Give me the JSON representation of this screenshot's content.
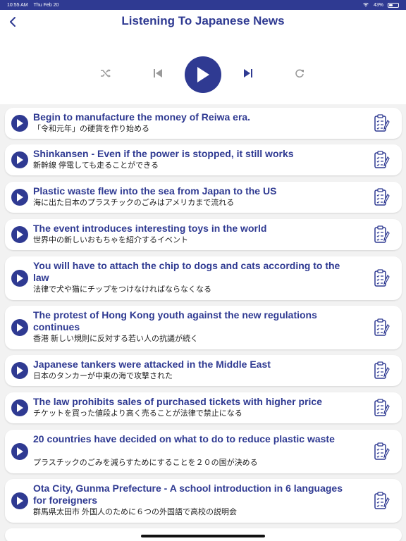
{
  "status_bar": {
    "time": "10:55 AM",
    "date": "Thu Feb 20",
    "battery": "43%",
    "battery_level": 0.43
  },
  "header": {
    "title": "Listening To Japanese News",
    "back_icon": "chevron-left-icon"
  },
  "player": {
    "shuffle_icon": "shuffle-icon",
    "prev_icon": "skip-previous-icon",
    "play_icon": "play-icon",
    "next_icon": "skip-next-icon",
    "repeat_icon": "repeat-icon"
  },
  "colors": {
    "primary": "#2f3a92",
    "background": "#f2f2f2",
    "card": "#ffffff"
  },
  "items": [
    {
      "en": "Begin to manufacture the money of Reiwa era.",
      "jp": "「令和元年」の硬貨を作り始める"
    },
    {
      "en": "Shinkansen - Even if the power is stopped, it still works",
      "jp": "新幹線 停電しても走ることができる"
    },
    {
      "en": "Plastic waste flew into the sea from Japan to the US",
      "jp": "海に出た日本のプラスチックのごみはアメリカまで流れる"
    },
    {
      "en": "The event introduces interesting toys in the world",
      "jp": "世界中の新しいおもちゃを紹介するイベント"
    },
    {
      "en": "You will have to attach the chip to dogs and cats according to the law",
      "jp": "法律で犬や猫にチップをつけなければならなくなる"
    },
    {
      "en": "The protest of Hong Kong youth against the new regulations continues",
      "jp": "香港 新しい規則に反対する若い人の抗議が続く"
    },
    {
      "en": "Japanese tankers were attacked in the Middle East",
      "jp": "日本のタンカーが中東の海で攻撃された"
    },
    {
      "en": "The law prohibits sales of purchased tickets with higher price",
      "jp": "チケットを買った値段より高く売ることが法律で禁止になる"
    },
    {
      "en": "20 countries have decided on what to do to reduce plastic waste",
      "jp": "プラスチックのごみを減らすためにすることを２０の国が決める"
    },
    {
      "en": "Ota City, Gunma Prefecture - A school introduction in 6 languages for foreigners",
      "jp": "群馬県太田市 外国人のために６つの外国語で高校の説明会"
    }
  ]
}
